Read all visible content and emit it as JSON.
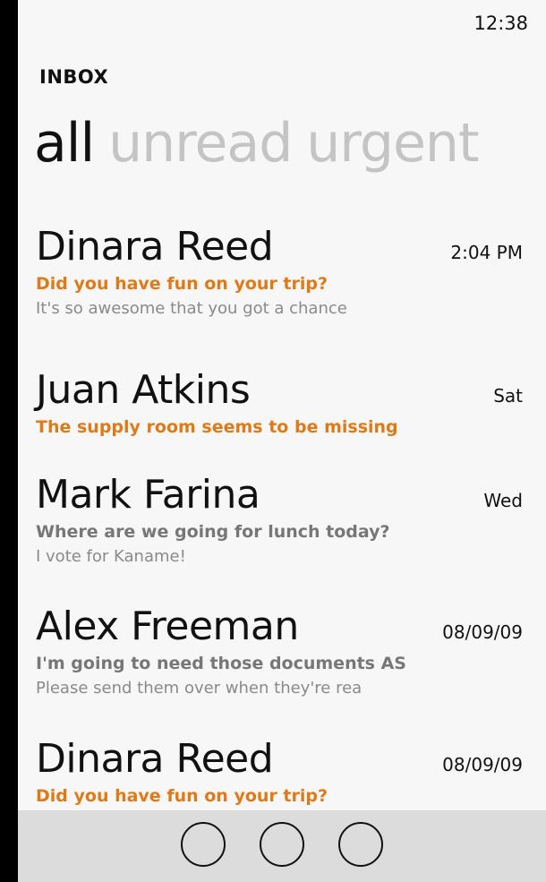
{
  "status": {
    "time": "12:38"
  },
  "app": {
    "title": "INBOX"
  },
  "pivot": {
    "items": [
      "all",
      "unread",
      "urgent"
    ],
    "selected": "all"
  },
  "messages": [
    {
      "sender": "Dinara Reed",
      "time": "2:04 PM",
      "subject": "Did you have fun on your trip?",
      "preview": "It's so awesome that you got a chance",
      "unread": true
    },
    {
      "sender": "Juan Atkins",
      "time": "Sat",
      "subject": "The supply room seems to be missing",
      "preview": "",
      "unread": true
    },
    {
      "sender": "Mark Farina",
      "time": "Wed",
      "subject": "Where are we going for lunch today?",
      "preview": "I vote for Kaname!",
      "unread": false
    },
    {
      "sender": "Alex Freeman",
      "time": "08/09/09",
      "subject": "I'm going to need those documents AS",
      "preview": "Please send them over when they're rea",
      "unread": false
    },
    {
      "sender": "Dinara Reed",
      "time": "08/09/09",
      "subject": "Did you have fun on your trip?",
      "preview": "",
      "unread": true
    }
  ],
  "appbar": {
    "buttons": [
      "appbar-button-1",
      "appbar-button-2",
      "appbar-button-3"
    ]
  },
  "colors": {
    "accent": "#e07a17",
    "background": "#f7f7f7",
    "appbar": "#dcdcdc"
  }
}
